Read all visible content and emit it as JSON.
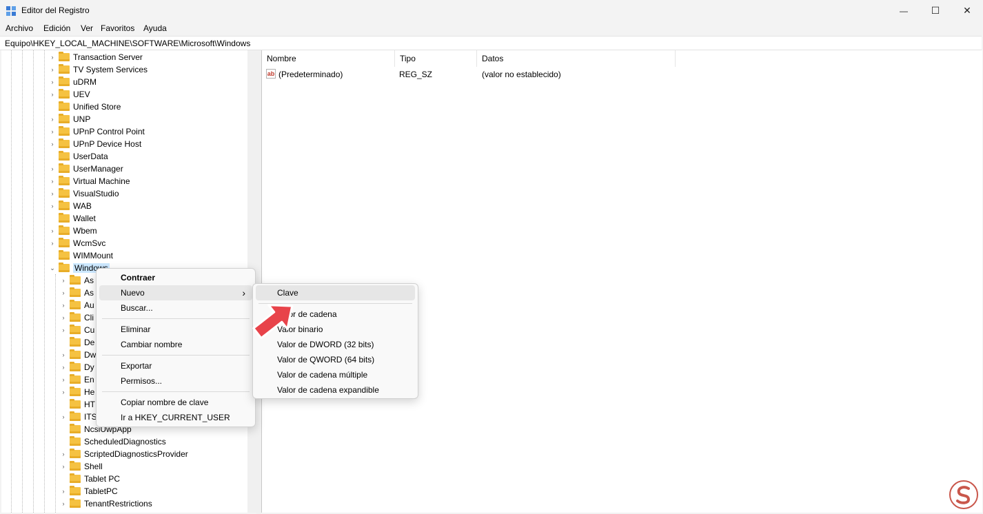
{
  "window": {
    "title": "Editor del Registro",
    "controls": {
      "minimize": "—",
      "maximize": "☐",
      "close": "✕"
    }
  },
  "menu": [
    "Archivo",
    "Edición",
    "Ver",
    "Favoritos",
    "Ayuda"
  ],
  "address": "Equipo\\HKEY_LOCAL_MACHINE\\SOFTWARE\\Microsoft\\Windows",
  "tree": {
    "items": [
      {
        "label": "Transaction Server",
        "chevron": "›"
      },
      {
        "label": "TV System Services",
        "chevron": "›"
      },
      {
        "label": "uDRM",
        "chevron": "›"
      },
      {
        "label": "UEV",
        "chevron": "›"
      },
      {
        "label": "Unified Store",
        "chevron": ""
      },
      {
        "label": "UNP",
        "chevron": "›"
      },
      {
        "label": "UPnP Control Point",
        "chevron": "›"
      },
      {
        "label": "UPnP Device Host",
        "chevron": "›"
      },
      {
        "label": "UserData",
        "chevron": ""
      },
      {
        "label": "UserManager",
        "chevron": "›"
      },
      {
        "label": "Virtual Machine",
        "chevron": "›"
      },
      {
        "label": "VisualStudio",
        "chevron": "›"
      },
      {
        "label": "WAB",
        "chevron": "›"
      },
      {
        "label": "Wallet",
        "chevron": ""
      },
      {
        "label": "Wbem",
        "chevron": "›"
      },
      {
        "label": "WcmSvc",
        "chevron": "›"
      },
      {
        "label": "WIMMount",
        "chevron": ""
      },
      {
        "label": "Windows",
        "chevron": "⌄",
        "selected": true
      }
    ],
    "children": [
      {
        "label": "As",
        "chevron": "›"
      },
      {
        "label": "As",
        "chevron": "›"
      },
      {
        "label": "Au",
        "chevron": "›"
      },
      {
        "label": "Cli",
        "chevron": "›"
      },
      {
        "label": "Cu",
        "chevron": "›"
      },
      {
        "label": "De",
        "chevron": ""
      },
      {
        "label": "Dw",
        "chevron": "›"
      },
      {
        "label": "Dy",
        "chevron": "›"
      },
      {
        "label": "En",
        "chevron": "›"
      },
      {
        "label": "He",
        "chevron": "›"
      },
      {
        "label": "HT",
        "chevron": ""
      },
      {
        "label": "ITS",
        "chevron": "›"
      },
      {
        "label": "NcsiUwpApp",
        "chevron": ""
      },
      {
        "label": "ScheduledDiagnostics",
        "chevron": ""
      },
      {
        "label": "ScriptedDiagnosticsProvider",
        "chevron": "›"
      },
      {
        "label": "Shell",
        "chevron": "›"
      },
      {
        "label": "Tablet PC",
        "chevron": ""
      },
      {
        "label": "TabletPC",
        "chevron": "›"
      },
      {
        "label": "TenantRestrictions",
        "chevron": "›"
      }
    ]
  },
  "list": {
    "columns": [
      "Nombre",
      "Tipo",
      "Datos"
    ],
    "rows": [
      {
        "icon": "ab",
        "name": "(Predeterminado)",
        "type": "REG_SZ",
        "data": "(valor no establecido)"
      }
    ]
  },
  "context_menu": {
    "groups": [
      [
        "Contraer"
      ],
      [
        "Nuevo",
        "Buscar..."
      ],
      [
        "Eliminar",
        "Cambiar nombre"
      ],
      [
        "Exportar",
        "Permisos..."
      ],
      [
        "Copiar nombre de clave",
        "Ir a HKEY_CURRENT_USER"
      ]
    ],
    "submenu_glyph": "›"
  },
  "submenu": {
    "items": [
      "Clave",
      "Valor de cadena",
      "Valor binario",
      "Valor de DWORD (32 bits)",
      "Valor de QWORD (64 bits)",
      "Valor de cadena múltiple",
      "Valor de cadena expandible"
    ]
  },
  "colors": {
    "folder": "#f5c242",
    "arrow": "#e8434a",
    "selection": "#cce8ff",
    "watermark": "#c0392b"
  }
}
